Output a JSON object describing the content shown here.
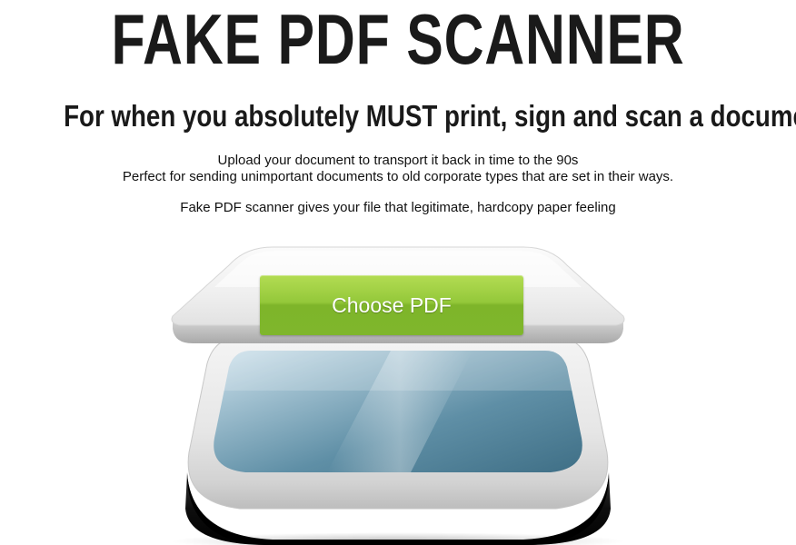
{
  "header": {
    "title": "FAKE PDF SCANNER",
    "subtitle": "For when you absolutely MUST print, sign and scan a document"
  },
  "description": {
    "line1": "Upload your document to transport it back in time to the 90s",
    "line2": "Perfect for sending unimportant documents to old corporate types that are set in their ways.",
    "line3": "Fake PDF scanner gives your file that legitimate, hardcopy paper feeling"
  },
  "upload": {
    "button_label": "Choose PDF"
  },
  "colors": {
    "button_green": "#8cc43a",
    "glass_blue": "#5f8fa6",
    "text": "#1a1a1a"
  }
}
